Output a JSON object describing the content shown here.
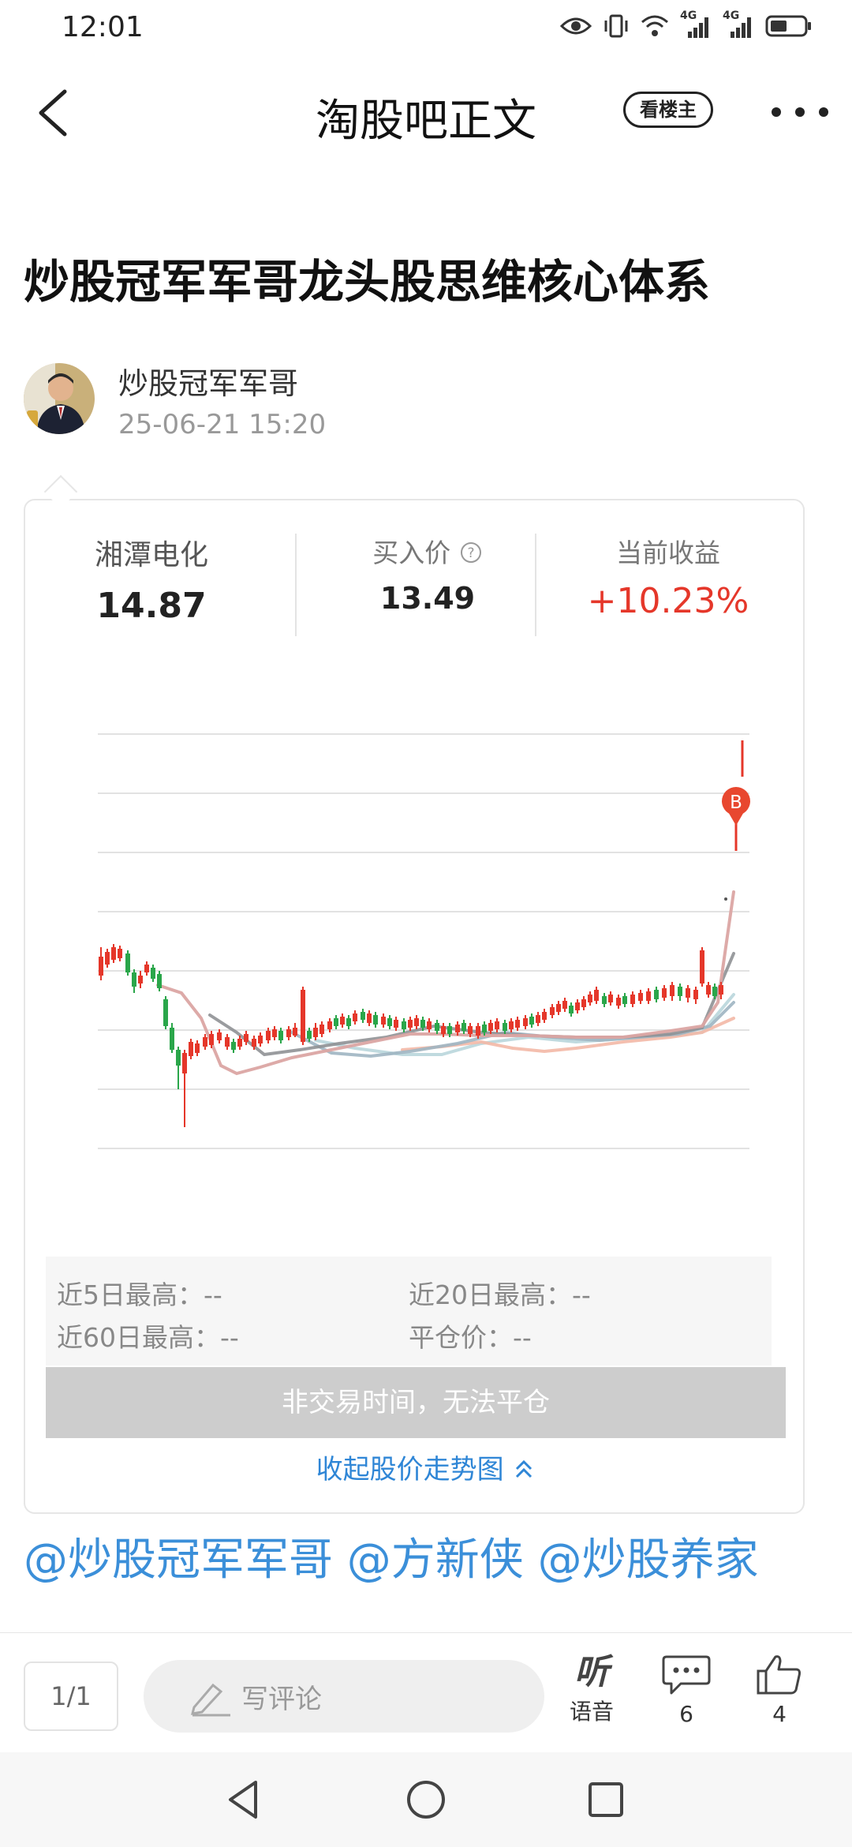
{
  "status_bar": {
    "time": "12:01",
    "net1": "4G",
    "net2": "4G"
  },
  "header": {
    "title": "淘股吧正文",
    "op_button": "看楼主"
  },
  "post": {
    "title": "炒股冠军军哥龙头股思维核心体系",
    "author": "炒股冠军军哥",
    "datetime": "25-06-21 15:20"
  },
  "stock_card": {
    "name": "湘潭电化",
    "price": "14.87",
    "buy_label": "买入价",
    "buy_price": "13.49",
    "return_label": "当前收益",
    "return_value": "+10.23%",
    "buy_marker": "B",
    "high5_label": "近5日最高：",
    "high5_value": "--",
    "high20_label": "近20日最高：",
    "high20_value": "--",
    "high60_label": "近60日最高：",
    "high60_value": "--",
    "close_label": "平仓价：",
    "close_value": "--",
    "close_button": "非交易时间，无法平仓",
    "collapse_label": "收起股价走势图"
  },
  "mentions": "@炒股冠军军哥 @方新侠 @炒股养家",
  "bottom_bar": {
    "page": "1/1",
    "comment_placeholder": "写评论",
    "listen_glyph": "听",
    "listen_label": "语音",
    "comment_count": "6",
    "like_count": "4"
  },
  "colors": {
    "rise": "#e5372a",
    "fall": "#2aa64a",
    "link": "#3b8fd9"
  }
}
